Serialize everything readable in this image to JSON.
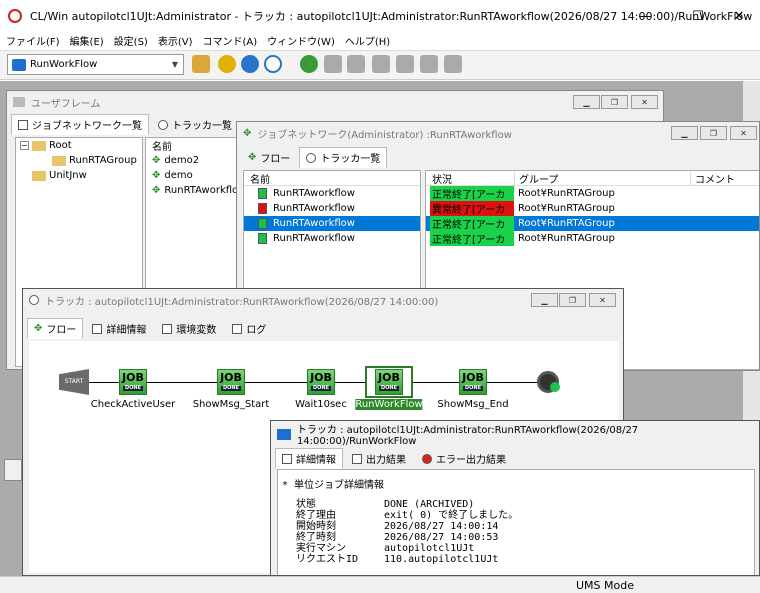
{
  "app": {
    "title": "CL/Win autopilotcl1UJt:Administrator - トラッカ : autopilotcl1UJt:Administrator:RunRTAworkflow(2026/08/27 14:00:00)/RunWorkFlow"
  },
  "window_controls": {
    "minimize": "—",
    "maximize": "☐",
    "close": "✕"
  },
  "menu": [
    "ファイル(F)",
    "編集(E)",
    "設定(S)",
    "表示(V)",
    "コマンド(A)",
    "ウィンドウ(W)",
    "ヘルプ(H)"
  ],
  "toolbar": {
    "combo_value": "RunWorkFlow"
  },
  "user_frame": {
    "title": "ユーザフレーム",
    "tabs": [
      "ジョブネットワーク一覧",
      "トラッカ一覧"
    ],
    "tree": [
      {
        "label": "Root",
        "level": 0
      },
      {
        "label": "RunRTAGroup",
        "level": 1
      },
      {
        "label": "UnitJnw",
        "level": 0
      }
    ],
    "list_header": "名前",
    "list": [
      "demo2",
      "demo",
      "RunRTAworkflow"
    ]
  },
  "jobnetwork_frame": {
    "title": "ジョブネットワーク(Administrator) :RunRTAworkflow",
    "tabs": [
      "フロー",
      "トラッカ一覧"
    ],
    "columns": [
      "名前",
      "状況",
      "グループ",
      "コメント"
    ],
    "rows": [
      {
        "name": "RunRTAworkflow",
        "status": "正常終了[アーカ",
        "status_kind": "ok",
        "group": "Root¥RunRTAGroup",
        "comment": "",
        "selected": false
      },
      {
        "name": "RunRTAworkflow",
        "status": "異常終了[アーカ",
        "status_kind": "ng",
        "group": "Root¥RunRTAGroup",
        "comment": "",
        "selected": false
      },
      {
        "name": "RunRTAworkflow",
        "status": "正常終了[アーカ",
        "status_kind": "ok",
        "group": "Root¥RunRTAGroup",
        "comment": "",
        "selected": true
      },
      {
        "name": "RunRTAworkflow",
        "status": "正常終了[アーカ",
        "status_kind": "ok",
        "group": "Root¥RunRTAGroup",
        "comment": "",
        "selected": false
      }
    ]
  },
  "tracker_frame": {
    "title": "トラッカ : autopilotcl1UJt:Administrator:RunRTAworkflow(2026/08/27 14:00:00)",
    "tabs": [
      "フロー",
      "詳細情報",
      "環境変数",
      "ログ"
    ],
    "start_label": "START",
    "nodes": [
      "CheckActiveUser",
      "ShowMsg_Start",
      "Wait10sec",
      "RunWorkFlow",
      "ShowMsg_End"
    ],
    "node_icon_text": "JOB",
    "node_badge": "DONE"
  },
  "job_tracker_frame": {
    "title": "トラッカ : autopilotcl1UJt:Administrator:RunRTAworkflow(2026/08/27 14:00:00)/RunWorkFlow",
    "tabs": [
      "詳細情報",
      "出力結果",
      "エラー出力結果"
    ],
    "heading": "* 単位ジョブ詳細情報",
    "details": [
      {
        "key": "状態",
        "value": "DONE (ARCHIVED)"
      },
      {
        "key": "終了理由",
        "value": "exit( 0) で終了しました。"
      },
      {
        "key": "開始時刻",
        "value": "2026/08/27 14:00:14"
      },
      {
        "key": "終了時刻",
        "value": "2026/08/27 14:00:53"
      },
      {
        "key": "実行マシン",
        "value": "autopilotcl1UJt"
      },
      {
        "key": "リクエストID",
        "value": "110.autopilotcl1UJt"
      }
    ]
  },
  "statusbar": {
    "mode": "UMS Mode"
  }
}
